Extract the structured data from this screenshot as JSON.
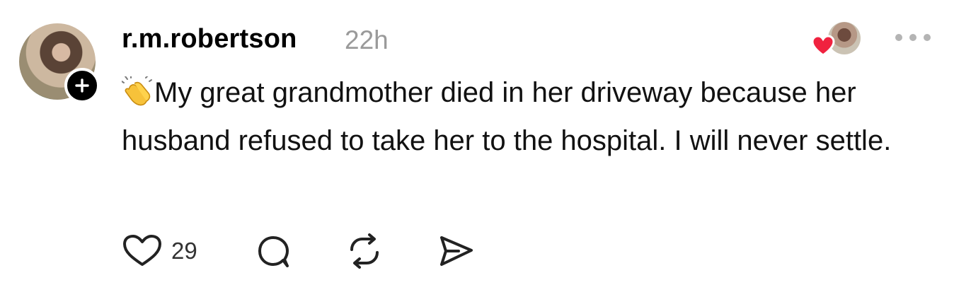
{
  "post": {
    "username": "r.m.robertson",
    "time": "22h",
    "emoji": "clapping-hands-emoji",
    "text": "My great grandmother died in her driveway because her husband refused to take her to the hospital. I will never settle."
  },
  "actions": {
    "like_count": "29"
  },
  "icons": {
    "follow": "plus-icon",
    "liked_by": "heart-icon",
    "more": "more-icon",
    "like": "heart-outline-icon",
    "reply": "comment-icon",
    "repost": "repost-icon",
    "share": "send-icon"
  },
  "colors": {
    "heart_red": "#f0223f",
    "timestamp_gray": "#9a9a9a",
    "icon_dark": "#222222"
  }
}
